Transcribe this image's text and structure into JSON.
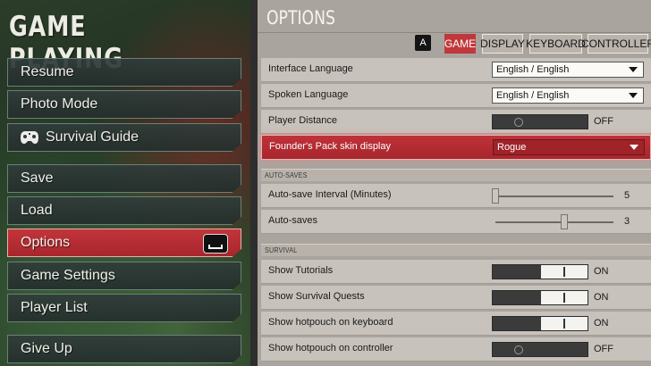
{
  "left_panel": {
    "title": "GAME PLAYING",
    "items": [
      {
        "label": "Resume"
      },
      {
        "label": "Photo Mode"
      },
      {
        "label": "Survival Guide",
        "icon": "gamepad-icon"
      },
      {
        "label": "Save"
      },
      {
        "label": "Load"
      },
      {
        "label": "Options",
        "active": true,
        "key_hint": "space-bar-key-icon"
      },
      {
        "label": "Game Settings"
      },
      {
        "label": "Player List"
      },
      {
        "label": "Give Up"
      }
    ]
  },
  "options": {
    "title": "OPTIONS",
    "tab_key": "A",
    "tabs": [
      {
        "label": "GAME",
        "active": true
      },
      {
        "label": "DISPLAY"
      },
      {
        "label": "KEYBOARD"
      },
      {
        "label": "CONTROLLER"
      }
    ],
    "rows": {
      "interface_language": {
        "label": "Interface Language",
        "value": "English / English"
      },
      "spoken_language": {
        "label": "Spoken Language",
        "value": "English / English"
      },
      "player_distance": {
        "label": "Player Distance",
        "state": "OFF"
      },
      "founders_pack": {
        "label": "Founder's Pack skin display",
        "value": "Rogue"
      }
    },
    "auto_saves": {
      "section_title": "AUTO-SAVES",
      "interval": {
        "label": "Auto-save Interval (Minutes)",
        "value": "5",
        "fraction": 0.0
      },
      "count": {
        "label": "Auto-saves",
        "value": "3",
        "fraction": 0.62
      }
    },
    "survival": {
      "section_title": "SURVIVAL",
      "tutorials": {
        "label": "Show Tutorials",
        "state": "ON"
      },
      "quests": {
        "label": "Show Survival Quests",
        "state": "ON"
      },
      "hotpouch_keyboard": {
        "label": "Show hotpouch on keyboard",
        "state": "ON"
      },
      "hotpouch_controller": {
        "label": "Show hotpouch on controller",
        "state": "OFF"
      }
    }
  },
  "colors": {
    "accent_red": "#c0383c",
    "panel_bg": "#aaa49e",
    "row_bg": "#c7c2bb"
  }
}
